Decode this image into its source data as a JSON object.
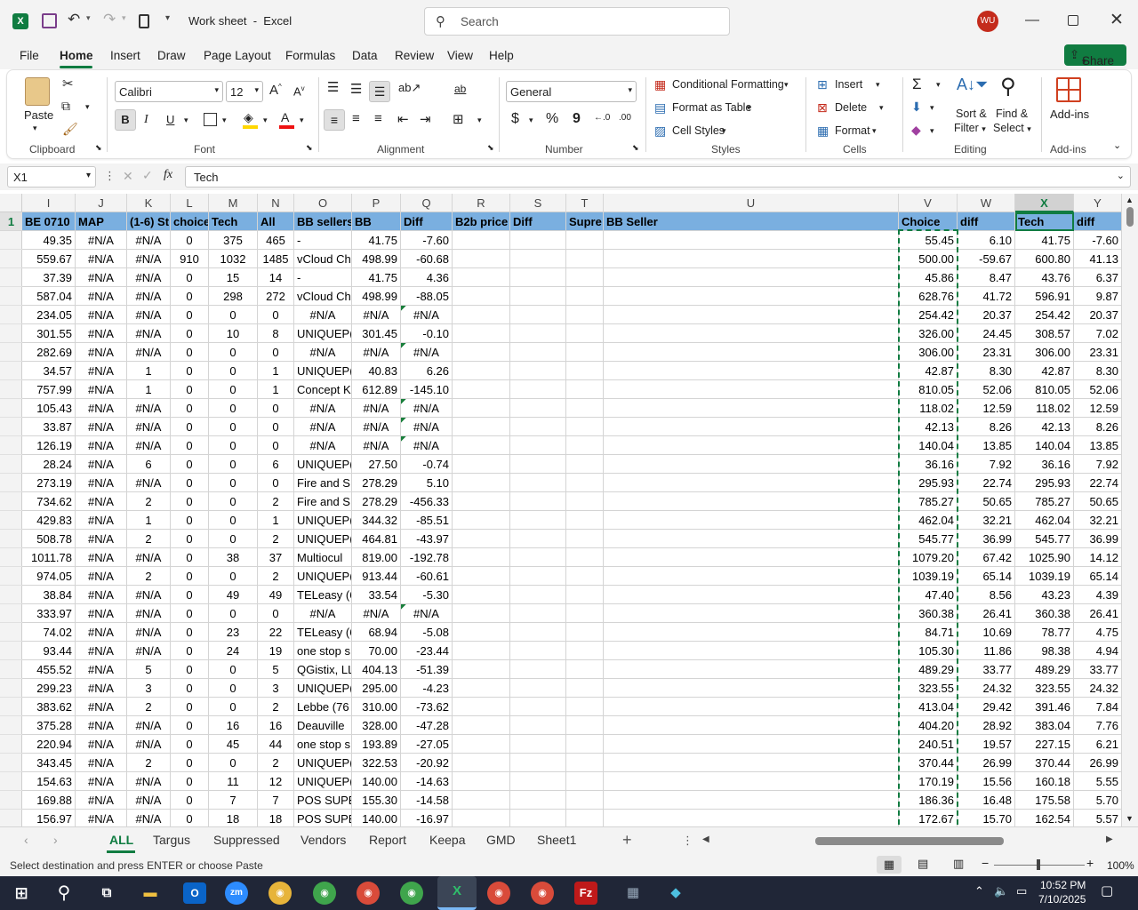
{
  "title": {
    "doc": "Work sheet",
    "app": "Excel",
    "search_placeholder": "Search",
    "user_initials": "WU"
  },
  "menu": [
    "File",
    "Home",
    "Insert",
    "Draw",
    "Page Layout",
    "Formulas",
    "Data",
    "Review",
    "View",
    "Help"
  ],
  "share_label": "Share",
  "ribbon": {
    "clipboard": {
      "paste": "Paste",
      "label": "Clipboard"
    },
    "font": {
      "name": "Calibri",
      "size": "12",
      "label": "Font",
      "bold": "B",
      "italic": "I",
      "underline": "U"
    },
    "alignment": {
      "label": "Alignment"
    },
    "number": {
      "format": "General",
      "label": "Number",
      "currency": "$",
      "percent": "%",
      "comma": "9"
    },
    "styles": {
      "cond": "Conditional Formatting",
      "table": "Format as Table",
      "cell": "Cell Styles",
      "label": "Styles"
    },
    "cells": {
      "insert": "Insert",
      "delete": "Delete",
      "format": "Format",
      "label": "Cells"
    },
    "editing": {
      "sort": "Sort &",
      "sort2": "Filter",
      "find": "Find &",
      "find2": "Select",
      "label": "Editing"
    },
    "addins": {
      "btn": "Add-ins",
      "label": "Add-ins"
    }
  },
  "formula_bar": {
    "name_box": "X1",
    "fx": "fx",
    "value": "Tech"
  },
  "columns": [
    "I",
    "J",
    "K",
    "L",
    "M",
    "N",
    "O",
    "P",
    "Q",
    "R",
    "S",
    "T",
    "U",
    "V",
    "W",
    "X",
    "Y"
  ],
  "headers": [
    "BE 0710",
    "MAP",
    "(1-6) St",
    "choice",
    "Tech",
    "All",
    "BB sellers",
    "BB",
    "Diff",
    "B2b price",
    "Diff",
    "Supre",
    "BB Seller",
    "Choice",
    "diff",
    "Tech",
    "diff"
  ],
  "rows": [
    [
      "49.35",
      "#N/A",
      "#N/A",
      "0",
      "375",
      "465",
      "-",
      "41.75",
      "-7.60",
      "",
      "",
      "",
      "",
      "55.45",
      "6.10",
      "41.75",
      "-7.60"
    ],
    [
      "559.67",
      "#N/A",
      "#N/A",
      "910",
      "1032",
      "1485",
      "vCloud Ch",
      "498.99",
      "-60.68",
      "",
      "",
      "",
      "",
      "500.00",
      "-59.67",
      "600.80",
      "41.13"
    ],
    [
      "37.39",
      "#N/A",
      "#N/A",
      "0",
      "15",
      "14",
      "-",
      "41.75",
      "4.36",
      "",
      "",
      "",
      "",
      "45.86",
      "8.47",
      "43.76",
      "6.37"
    ],
    [
      "587.04",
      "#N/A",
      "#N/A",
      "0",
      "298",
      "272",
      "vCloud Ch",
      "498.99",
      "-88.05",
      "",
      "",
      "",
      "",
      "628.76",
      "41.72",
      "596.91",
      "9.87"
    ],
    [
      "234.05",
      "#N/A",
      "#N/A",
      "0",
      "0",
      "0",
      "#N/A",
      "#N/A",
      "#N/A",
      "",
      "",
      "",
      "",
      "254.42",
      "20.37",
      "254.42",
      "20.37"
    ],
    [
      "301.55",
      "#N/A",
      "#N/A",
      "0",
      "10",
      "8",
      "UNIQUEP(",
      "301.45",
      "-0.10",
      "",
      "",
      "",
      "",
      "326.00",
      "24.45",
      "308.57",
      "7.02"
    ],
    [
      "282.69",
      "#N/A",
      "#N/A",
      "0",
      "0",
      "0",
      "#N/A",
      "#N/A",
      "#N/A",
      "",
      "",
      "",
      "",
      "306.00",
      "23.31",
      "306.00",
      "23.31"
    ],
    [
      "34.57",
      "#N/A",
      "1",
      "0",
      "0",
      "1",
      "UNIQUEP(",
      "40.83",
      "6.26",
      "",
      "",
      "",
      "",
      "42.87",
      "8.30",
      "42.87",
      "8.30"
    ],
    [
      "757.99",
      "#N/A",
      "1",
      "0",
      "0",
      "1",
      "Concept K",
      "612.89",
      "-145.10",
      "",
      "",
      "",
      "",
      "810.05",
      "52.06",
      "810.05",
      "52.06"
    ],
    [
      "105.43",
      "#N/A",
      "#N/A",
      "0",
      "0",
      "0",
      "#N/A",
      "#N/A",
      "#N/A",
      "",
      "",
      "",
      "",
      "118.02",
      "12.59",
      "118.02",
      "12.59"
    ],
    [
      "33.87",
      "#N/A",
      "#N/A",
      "0",
      "0",
      "0",
      "#N/A",
      "#N/A",
      "#N/A",
      "",
      "",
      "",
      "",
      "42.13",
      "8.26",
      "42.13",
      "8.26"
    ],
    [
      "126.19",
      "#N/A",
      "#N/A",
      "0",
      "0",
      "0",
      "#N/A",
      "#N/A",
      "#N/A",
      "",
      "",
      "",
      "",
      "140.04",
      "13.85",
      "140.04",
      "13.85"
    ],
    [
      "28.24",
      "#N/A",
      "6",
      "0",
      "0",
      "6",
      "UNIQUEP(",
      "27.50",
      "-0.74",
      "",
      "",
      "",
      "",
      "36.16",
      "7.92",
      "36.16",
      "7.92"
    ],
    [
      "273.19",
      "#N/A",
      "#N/A",
      "0",
      "0",
      "0",
      "Fire and S",
      "278.29",
      "5.10",
      "",
      "",
      "",
      "",
      "295.93",
      "22.74",
      "295.93",
      "22.74"
    ],
    [
      "734.62",
      "#N/A",
      "2",
      "0",
      "0",
      "2",
      "Fire and S",
      "278.29",
      "-456.33",
      "",
      "",
      "",
      "",
      "785.27",
      "50.65",
      "785.27",
      "50.65"
    ],
    [
      "429.83",
      "#N/A",
      "1",
      "0",
      "0",
      "1",
      "UNIQUEP(",
      "344.32",
      "-85.51",
      "",
      "",
      "",
      "",
      "462.04",
      "32.21",
      "462.04",
      "32.21"
    ],
    [
      "508.78",
      "#N/A",
      "2",
      "0",
      "0",
      "2",
      "UNIQUEP(",
      "464.81",
      "-43.97",
      "",
      "",
      "",
      "",
      "545.77",
      "36.99",
      "545.77",
      "36.99"
    ],
    [
      "1011.78",
      "#N/A",
      "#N/A",
      "0",
      "38",
      "37",
      "Multiocul",
      "819.00",
      "-192.78",
      "",
      "",
      "",
      "",
      "1079.20",
      "67.42",
      "1025.90",
      "14.12"
    ],
    [
      "974.05",
      "#N/A",
      "2",
      "0",
      "0",
      "2",
      "UNIQUEP(",
      "913.44",
      "-60.61",
      "",
      "",
      "",
      "",
      "1039.19",
      "65.14",
      "1039.19",
      "65.14"
    ],
    [
      "38.84",
      "#N/A",
      "#N/A",
      "0",
      "49",
      "49",
      "TELeasy (6",
      "33.54",
      "-5.30",
      "",
      "",
      "",
      "",
      "47.40",
      "8.56",
      "43.23",
      "4.39"
    ],
    [
      "333.97",
      "#N/A",
      "#N/A",
      "0",
      "0",
      "0",
      "#N/A",
      "#N/A",
      "#N/A",
      "",
      "",
      "",
      "",
      "360.38",
      "26.41",
      "360.38",
      "26.41"
    ],
    [
      "74.02",
      "#N/A",
      "#N/A",
      "0",
      "23",
      "22",
      "TELeasy (6",
      "68.94",
      "-5.08",
      "",
      "",
      "",
      "",
      "84.71",
      "10.69",
      "78.77",
      "4.75"
    ],
    [
      "93.44",
      "#N/A",
      "#N/A",
      "0",
      "24",
      "19",
      "one stop s",
      "70.00",
      "-23.44",
      "",
      "",
      "",
      "",
      "105.30",
      "11.86",
      "98.38",
      "4.94"
    ],
    [
      "455.52",
      "#N/A",
      "5",
      "0",
      "0",
      "5",
      "QGistix, LL",
      "404.13",
      "-51.39",
      "",
      "",
      "",
      "",
      "489.29",
      "33.77",
      "489.29",
      "33.77"
    ],
    [
      "299.23",
      "#N/A",
      "3",
      "0",
      "0",
      "3",
      "UNIQUEP(",
      "295.00",
      "-4.23",
      "",
      "",
      "",
      "",
      "323.55",
      "24.32",
      "323.55",
      "24.32"
    ],
    [
      "383.62",
      "#N/A",
      "2",
      "0",
      "0",
      "2",
      "Lebbe (76",
      "310.00",
      "-73.62",
      "",
      "",
      "",
      "",
      "413.04",
      "29.42",
      "391.46",
      "7.84"
    ],
    [
      "375.28",
      "#N/A",
      "#N/A",
      "0",
      "16",
      "16",
      "Deauville",
      "328.00",
      "-47.28",
      "",
      "",
      "",
      "",
      "404.20",
      "28.92",
      "383.04",
      "7.76"
    ],
    [
      "220.94",
      "#N/A",
      "#N/A",
      "0",
      "45",
      "44",
      "one stop s",
      "193.89",
      "-27.05",
      "",
      "",
      "",
      "",
      "240.51",
      "19.57",
      "227.15",
      "6.21"
    ],
    [
      "343.45",
      "#N/A",
      "2",
      "0",
      "0",
      "2",
      "UNIQUEP(",
      "322.53",
      "-20.92",
      "",
      "",
      "",
      "",
      "370.44",
      "26.99",
      "370.44",
      "26.99"
    ],
    [
      "154.63",
      "#N/A",
      "#N/A",
      "0",
      "11",
      "12",
      "UNIQUEP(",
      "140.00",
      "-14.63",
      "",
      "",
      "",
      "",
      "170.19",
      "15.56",
      "160.18",
      "5.55"
    ],
    [
      "169.88",
      "#N/A",
      "#N/A",
      "0",
      "7",
      "7",
      "POS SUPEI",
      "155.30",
      "-14.58",
      "",
      "",
      "",
      "",
      "186.36",
      "16.48",
      "175.58",
      "5.70"
    ],
    [
      "156.97",
      "#N/A",
      "#N/A",
      "0",
      "18",
      "18",
      "POS SUPEI",
      "140.00",
      "-16.97",
      "",
      "",
      "",
      "",
      "172.67",
      "15.70",
      "162.54",
      "5.57"
    ]
  ],
  "sheets": [
    "ALL",
    "Targus",
    "Suppressed",
    "Vendors",
    "Report",
    "Keepa",
    "GMD",
    "Sheet1"
  ],
  "active_sheet": "ALL",
  "status": {
    "message": "Select destination and press ENTER or choose Paste",
    "zoom": "100%"
  },
  "taskbar": {
    "time": "10:52 PM",
    "date": "7/10/2025"
  },
  "colors": {
    "header_fill": "#7aafe0",
    "accent": "#107c41",
    "user_badge": "#c42b1c"
  }
}
